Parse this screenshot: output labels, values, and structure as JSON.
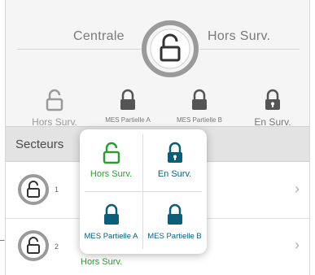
{
  "header": {
    "left_label": "Centrale",
    "right_label": "Hors Surv."
  },
  "modes": [
    {
      "label": "Hors Surv.",
      "icon": "unlock-icon",
      "color": "#9a9a9a"
    },
    {
      "label": "MES Partielle A",
      "icon": "lock-icon",
      "color": "#555555"
    },
    {
      "label": "MES Partielle B",
      "icon": "lock-icon",
      "color": "#555555"
    },
    {
      "label": "En Surv.",
      "icon": "lock-keyhole-icon",
      "color": "#555555"
    }
  ],
  "section": {
    "title": "Secteurs"
  },
  "rows": [
    {
      "number": "1"
    },
    {
      "number": "2",
      "status": "Hors Surv."
    }
  ],
  "popup": {
    "options": [
      {
        "label": "Hors Surv.",
        "color": "#2a9d2f",
        "icon": "unlock-icon"
      },
      {
        "label": "En Surv.",
        "color": "#0a5e7c",
        "icon": "lock-keyhole-icon"
      },
      {
        "label": "MES Partielle A",
        "color": "#0a5e7c",
        "icon": "lock-icon"
      },
      {
        "label": "MES Partielle B",
        "color": "#0a5e7c",
        "icon": "lock-icon"
      }
    ]
  },
  "colors": {
    "green": "#2a9d2f",
    "teal": "#0a5e7c",
    "gray": "#555555"
  }
}
